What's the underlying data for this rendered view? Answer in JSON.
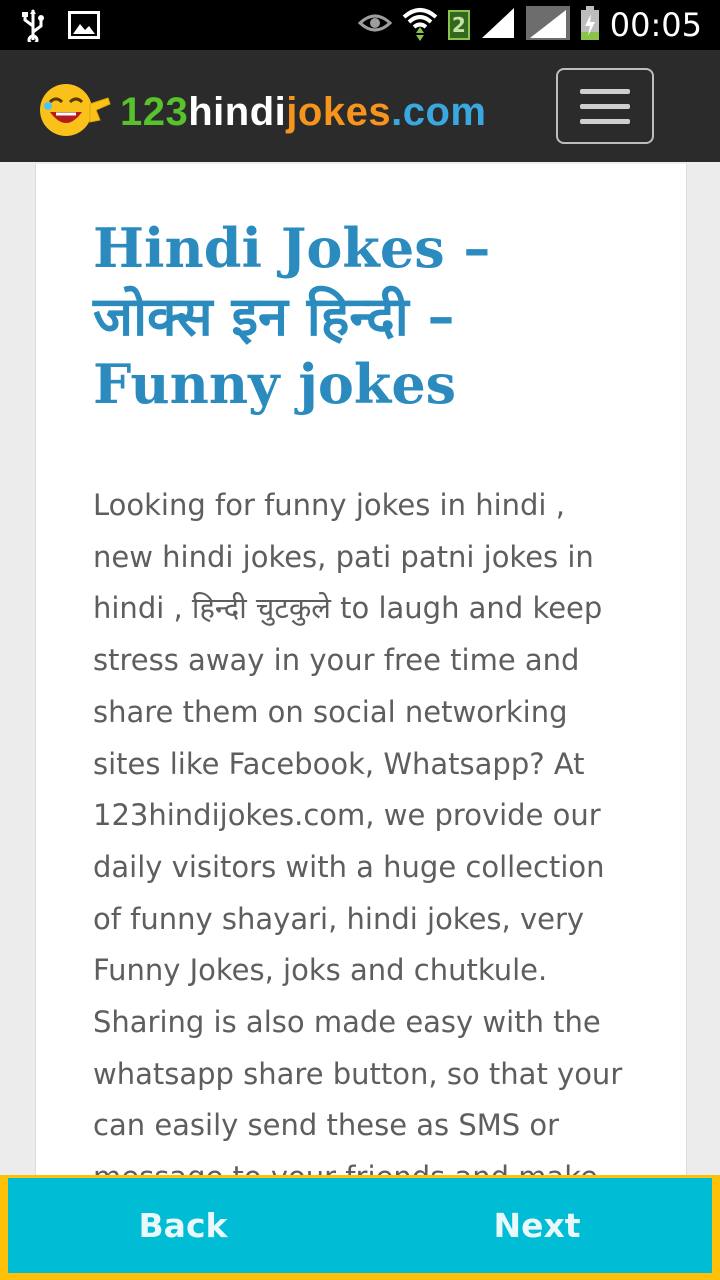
{
  "status_bar": {
    "time": "00:05",
    "data_badge": "2",
    "icons": [
      "usb-icon",
      "image-icon",
      "eye-icon",
      "wifi-icon",
      "signal-icon",
      "signal-icon-2",
      "battery-charging-icon"
    ]
  },
  "header": {
    "logo": {
      "num": "123",
      "hindi": "hindi",
      "jokes": "jokes",
      "com": ".com"
    },
    "menu_icon": "hamburger-menu-icon"
  },
  "page": {
    "title_lines": [
      "Hindi Jokes –",
      "जोक्स इन हिन्दी –",
      "Funny jokes"
    ],
    "intro_lines": [
      "Looking for funny jokes in hindi ,",
      "new hindi jokes, pati patni jokes in",
      "hindi , हिन्दी चुटकुले to laugh and keep",
      "stress away in your free time and",
      "share them on social networking",
      "sites like Facebook, Whatsapp? At",
      "123hindijokes.com, we provide our",
      "daily visitors with a huge collection",
      "of funny shayari, hindi jokes, very",
      "Funny Jokes, joks and chutkule.",
      "Sharing is also made easy with the",
      "whatsapp share button, so that your",
      "can easily send these as SMS or",
      "message to your friends and make"
    ]
  },
  "bottom_nav": {
    "back_label": "Back",
    "next_label": "Next"
  },
  "colors": {
    "header_bg": "#2b2b2b",
    "title": "#2b8bbf",
    "nav_bg": "#00bcd4",
    "nav_border": "#ffc107"
  }
}
